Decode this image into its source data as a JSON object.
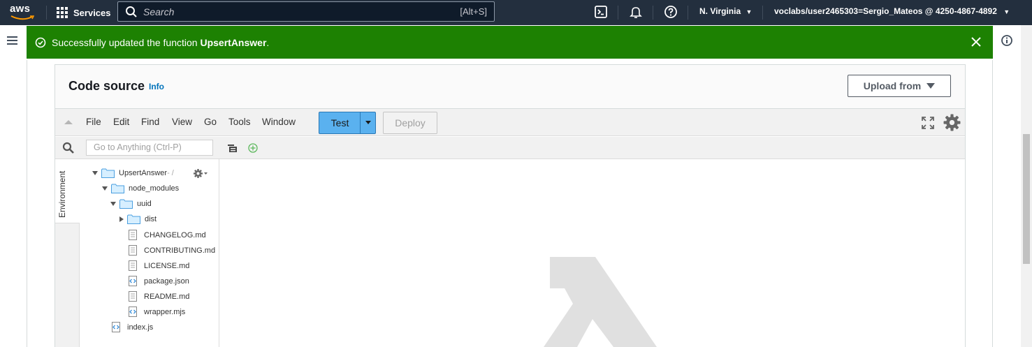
{
  "topnav": {
    "logo_text": "aws",
    "services_label": "Services",
    "search_placeholder": "Search",
    "search_shortcut": "[Alt+S]",
    "region": "N. Virginia",
    "account": "voclabs/user2465303=Sergio_Mateos @ 4250-4867-4892",
    "icons": [
      "cloudshell-icon",
      "notifications-icon",
      "help-icon"
    ]
  },
  "flash": {
    "prefix": "Successfully updated the function ",
    "function_name": "UpsertAnswer",
    "suffix": ".",
    "color": "#1d8102"
  },
  "code_source": {
    "title": "Code source",
    "info_label": "Info",
    "upload_label": "Upload from"
  },
  "ide": {
    "menu": [
      "File",
      "Edit",
      "Find",
      "View",
      "Go",
      "Tools",
      "Window"
    ],
    "test_label": "Test",
    "deploy_label": "Deploy",
    "goto_placeholder": "Go to Anything (Ctrl-P)",
    "environment_tab": "Environment",
    "accent": "#5ab1ef",
    "tree": [
      {
        "name": "UpsertAnswer",
        "suffix": " - /",
        "kind": "folder",
        "state": "expanded"
      },
      {
        "name": "node_modules",
        "kind": "folder",
        "state": "expanded"
      },
      {
        "name": "uuid",
        "kind": "folder",
        "state": "expanded"
      },
      {
        "name": "dist",
        "kind": "folder",
        "state": "collapsed"
      },
      {
        "name": "CHANGELOG.md",
        "kind": "file"
      },
      {
        "name": "CONTRIBUTING.md",
        "kind": "file"
      },
      {
        "name": "LICENSE.md",
        "kind": "file"
      },
      {
        "name": "package.json",
        "kind": "code-file"
      },
      {
        "name": "README.md",
        "kind": "file"
      },
      {
        "name": "wrapper.mjs",
        "kind": "code-file"
      },
      {
        "name": "index.js",
        "kind": "code-file"
      }
    ]
  }
}
